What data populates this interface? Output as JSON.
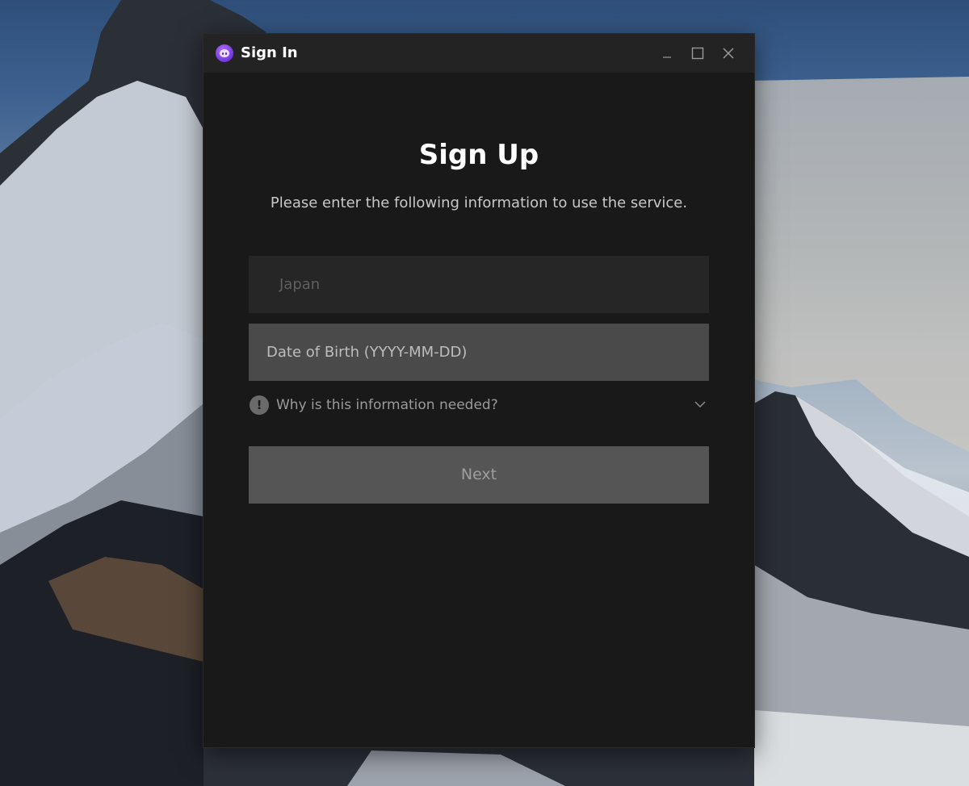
{
  "window": {
    "title": "Sign In",
    "controls": [
      "minimize-icon",
      "maximize-icon",
      "close-icon"
    ]
  },
  "form": {
    "heading": "Sign Up",
    "subtext": "Please enter the following information to use the service.",
    "country_value": "Japan",
    "dob_placeholder": "Date of Birth (YYYY-MM-DD)",
    "info_toggle_label": "Why is this information needed?",
    "info_icon_glyph": "!",
    "next_label": "Next"
  },
  "colors": {
    "window_bg": "#191919",
    "titlebar_bg": "#232323",
    "field_disabled_bg": "#262626",
    "field_bg": "#4a4a4a",
    "button_disabled_bg": "#555555",
    "app_icon_accent": "#7b3fe4"
  }
}
